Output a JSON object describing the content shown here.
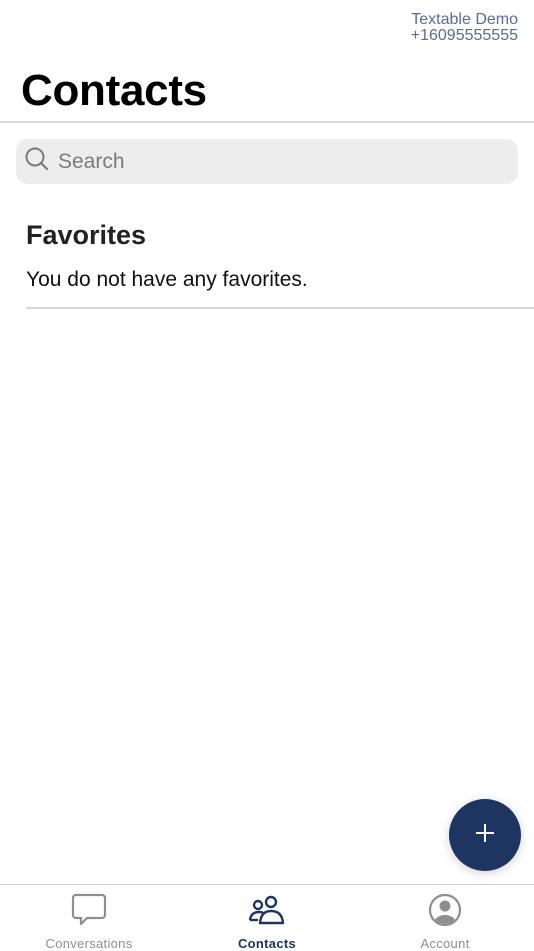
{
  "header": {
    "account_name": "Textable Demo",
    "phone_number": "+16095555555",
    "title": "Contacts"
  },
  "search": {
    "placeholder": "Search",
    "value": "",
    "icon": "search-icon"
  },
  "favorites": {
    "title": "Favorites",
    "empty_message": "You do not have any favorites."
  },
  "fab": {
    "icon": "plus-icon",
    "action": "add-contact"
  },
  "tabbar": {
    "tabs": [
      {
        "label": "Conversations",
        "icon": "chat-bubble-icon",
        "active": false
      },
      {
        "label": "Contacts",
        "icon": "people-icon",
        "active": true
      },
      {
        "label": "Account",
        "icon": "account-circle-icon",
        "active": false
      }
    ]
  },
  "colors": {
    "accent": "#1d3560",
    "inactive_tab": "#8e8e8e",
    "account_text": "#5a6d8f",
    "search_bg": "#ededed"
  }
}
